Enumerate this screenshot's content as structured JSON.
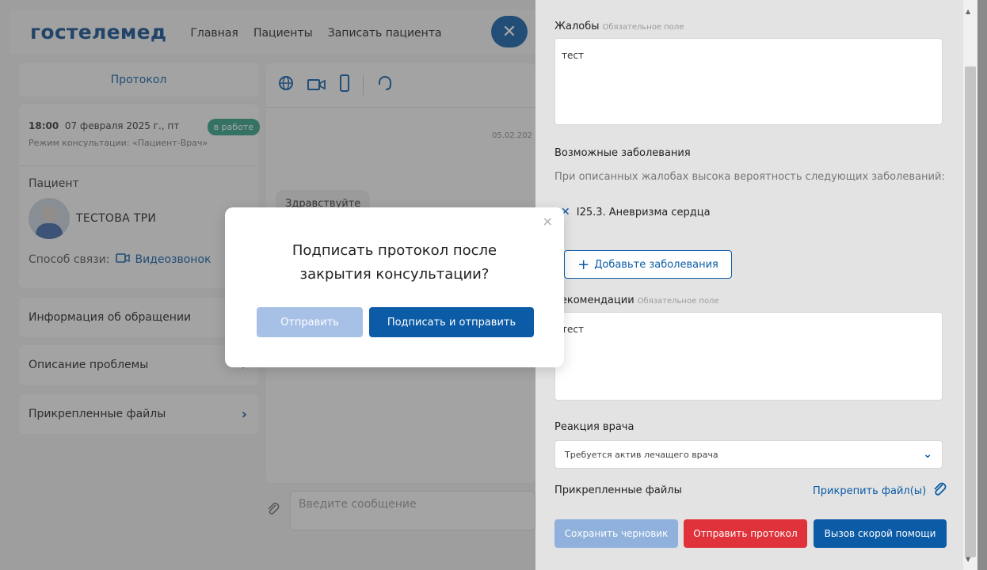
{
  "header": {
    "logo": "гостелемед",
    "nav": [
      "Главная",
      "Пациенты",
      "Записать пациента"
    ],
    "close_icon": "✕"
  },
  "left": {
    "protocol_button": "Протокол",
    "appointment": {
      "time": "18:00",
      "date": "07 февраля 2025 г., пт",
      "mode": "Режим консультации: «Пациент-Врач»",
      "status": "в работе"
    },
    "patient_label": "Пациент",
    "patient_name": "ТЕСТОВА ТРИ",
    "contact_label": "Способ связи:",
    "contact_value": "Видеозвонок",
    "sections": [
      "Информация об обращении",
      "Описание проблемы",
      "Прикрепленные файлы"
    ]
  },
  "chat": {
    "date": "05.02.202",
    "bubble": "Здравствуйте",
    "input_placeholder": "Введите сообщение"
  },
  "panel": {
    "complaints_label": "Жалобы",
    "required_hint": "Обязательное поле",
    "complaints_value": "тест",
    "diseases_label": "Возможные заболевания",
    "diseases_sub": "При описанных жалобах высока вероятность следующих заболеваний:",
    "disease_item": "I25.3. Аневризма сердца",
    "add_disease": "Добавьте заболевания",
    "recommend_label": "Рекомендации",
    "recommend_value": "тест",
    "reaction_label": "Реакция врача",
    "reaction_value": "Требуется актив лечащего врача",
    "files_label": "Прикрепленные файлы",
    "attach_link": "Прикрепить файл(ы)",
    "save_draft": "Сохранить черновик",
    "send_protocol": "Отправить протокол",
    "ambulance": "Вызов скорой помощи"
  },
  "modal": {
    "title_line1": "Подписать протокол после",
    "title_line2": "закрытия консультации?",
    "send": "Отправить",
    "sign_send": "Подписать и отправить"
  },
  "colors": {
    "brand": "#0b5ba6",
    "danger": "#e0323a",
    "success": "#2f9e86"
  }
}
